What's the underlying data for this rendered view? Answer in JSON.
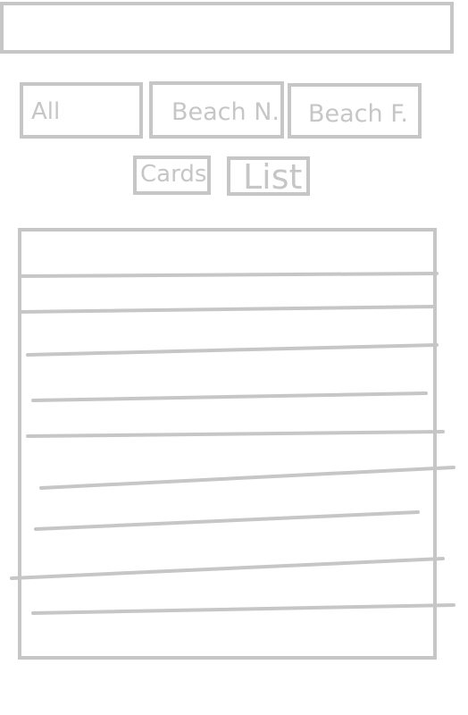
{
  "search_bar": {
    "value": ""
  },
  "filters": {
    "all_label": "All",
    "beach_n_label": "Beach N.",
    "beach_f_label": "Beach F."
  },
  "view_toggle": {
    "cards_label": "Cards",
    "list_label": "List"
  },
  "list": {
    "rows": 9
  },
  "colors": {
    "wireframe_stroke": "#c6c6c6",
    "background": "#ffffff"
  }
}
